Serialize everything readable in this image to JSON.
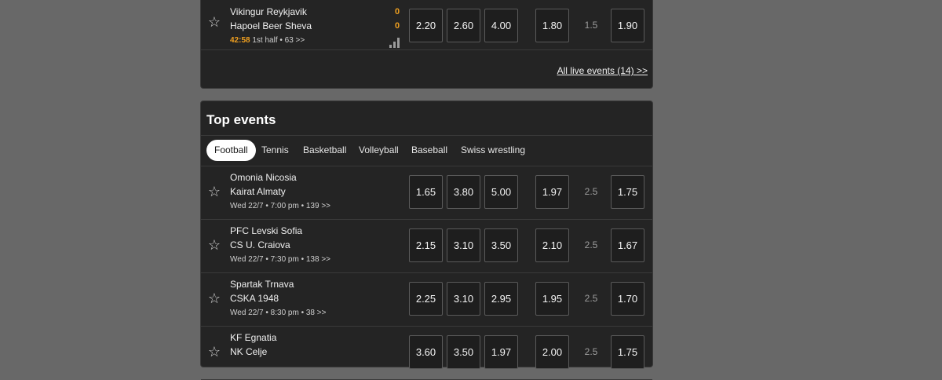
{
  "live": {
    "events": [
      {
        "team1": "Vikingur Reykjavik",
        "team2": "Hapoel Beer Sheva",
        "score1": "0",
        "score2": "0",
        "time": "42:58",
        "info": "1st half • 63 >>",
        "odds": [
          "2.20",
          "2.60",
          "4.00",
          "1.80",
          "1.90"
        ],
        "handicap": "1.5"
      }
    ],
    "all_live_link": "All live events (14) >>"
  },
  "top": {
    "title": "Top events",
    "tabs": [
      "Football",
      "Tennis",
      "Basketball",
      "Volleyball",
      "Baseball",
      "Swiss wrestling"
    ],
    "active_tab": "Football",
    "events": [
      {
        "team1": "Omonia Nicosia",
        "team2": "Kairat Almaty",
        "meta": "Wed 22/7 • 7:00 pm • 139 >>",
        "odds": [
          "1.65",
          "3.80",
          "5.00",
          "1.97",
          "1.75"
        ],
        "handicap": "2.5"
      },
      {
        "team1": "PFC Levski Sofia",
        "team2": "CS U. Craiova",
        "meta": "Wed 22/7 • 7:30 pm • 138 >>",
        "odds": [
          "2.15",
          "3.10",
          "3.50",
          "2.10",
          "1.67"
        ],
        "handicap": "2.5"
      },
      {
        "team1": "Spartak Trnava",
        "team2": "CSKA 1948",
        "meta": "Wed 22/7 • 8:30 pm • 38 >>",
        "odds": [
          "2.25",
          "3.10",
          "2.95",
          "1.95",
          "1.70"
        ],
        "handicap": "2.5"
      },
      {
        "team1": "KF Egnatia",
        "team2": "NK Celje",
        "meta": "",
        "odds": [
          "3.60",
          "3.50",
          "1.97",
          "2.00",
          "1.75"
        ],
        "handicap": "2.5"
      }
    ]
  }
}
